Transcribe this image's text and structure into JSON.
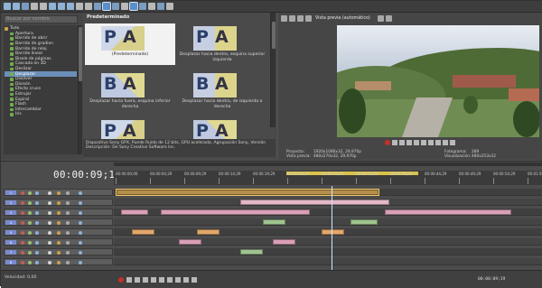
{
  "explorer": {
    "search_placeholder": "Buscar por nombre",
    "tree": [
      {
        "label": "Todo",
        "level": 0,
        "root": true
      },
      {
        "label": "Apertura",
        "level": 1
      },
      {
        "label": "Barrido de abrir",
        "level": 1
      },
      {
        "label": "Barrido de gradien",
        "level": 1
      },
      {
        "label": "Barrido de reloj",
        "level": 1
      },
      {
        "label": "Barrido lineal",
        "level": 1
      },
      {
        "label": "Bisele de páginas",
        "level": 1
      },
      {
        "label": "Cascada en 3D",
        "level": 1
      },
      {
        "label": "Deslizar",
        "level": 1
      },
      {
        "label": "Desplazar",
        "level": 1,
        "selected": true
      },
      {
        "label": "Disolver",
        "level": 1
      },
      {
        "label": "Divisón",
        "level": 1
      },
      {
        "label": "Efecto cruce",
        "level": 1
      },
      {
        "label": "Estrujar",
        "level": 1
      },
      {
        "label": "Espiral",
        "level": 1
      },
      {
        "label": "Flash",
        "level": 1
      },
      {
        "label": "Intercambiar",
        "level": 1
      },
      {
        "label": "Iris",
        "level": 1
      }
    ],
    "grid_title": "Predeterminado",
    "tiles": [
      {
        "letters": "PA",
        "caption": "(Predeterminado)",
        "selected": true
      },
      {
        "letters": "PA",
        "caption": "Desplazar hacia dentro, esquina superior izquierda"
      },
      {
        "letters": "BA",
        "caption": "Desplazar hacia fuera, esquina inferior derecha"
      },
      {
        "letters": "BA",
        "caption": "Desplazar hacia dentro, de izquierda a derecha"
      },
      {
        "letters": "PA",
        "caption": ""
      },
      {
        "letters": "PA",
        "caption": ""
      }
    ],
    "description_1": "Dispositivo Sony GPX, Puede Ruido de 12 bits, GPU acelerada, Agrupación Sony, Versión",
    "description_2": "Descripción: De Sony Creative Software Inc.",
    "tabs": [
      "Medios de proyecto",
      "Explorador",
      "Transiciones",
      "Efectos de vídeo",
      "Generadores de medios"
    ],
    "active_tab": 2
  },
  "preview": {
    "mode_label": "Vista previa (automático)",
    "info": {
      "proyecto_label": "Proyecto:",
      "proyecto_value": "1920x1080x32, 29,970p",
      "vista_label": "Vista previa:",
      "vista_value": "480x270x32, 29,970p",
      "fotograma_label": "Fotograma:",
      "fotograma_value": "289",
      "visualizacion_label": "Visualización:",
      "visualizacion_value": "480x253x32"
    }
  },
  "timeline": {
    "timecode": "00:00:09;19",
    "ruler_labels": [
      "00:00:00;00",
      "00:00:04;29",
      "00:00:09;29",
      "00:00:14;29",
      "00:00:19;29",
      "00:00:24;29",
      "00:00:29;29",
      "00:00:34;29",
      "00:00:39;29",
      "00:00:44;29",
      "00:00:49;29",
      "00:00:54;29",
      "00:01:59;28"
    ],
    "track_numbers": [
      "1",
      "2",
      "3",
      "4",
      "5",
      "6",
      "7",
      "8"
    ],
    "rate_label": "Velocidad: 0,00",
    "bottom_timecode": "00:00:09;19"
  },
  "colors": {
    "selected_track": "#7a8ad0",
    "pink_event": "#d9a0b7",
    "orange_event": "#e2a76a",
    "green_event": "#9fc38e",
    "loop_region": "#d9c24a"
  }
}
